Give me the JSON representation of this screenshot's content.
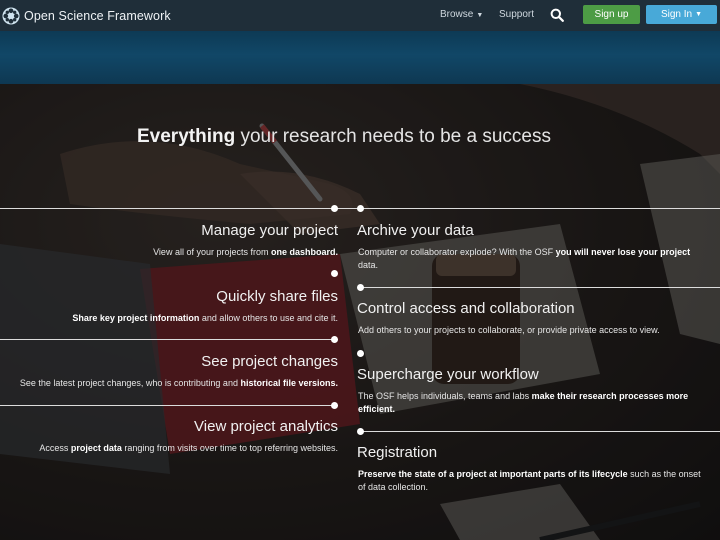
{
  "navbar": {
    "brand": "Open Science Framework",
    "browse_label": "Browse",
    "support_label": "Support",
    "signup_label": "Sign up",
    "signin_label": "Sign In",
    "colors": {
      "bar": "#1f2e39",
      "signup": "#4d9c45",
      "signin": "#48a9d8"
    }
  },
  "section": {
    "title_bold": "Everything",
    "title_rest": " your research needs to be a success"
  },
  "features_left": [
    {
      "title": "Manage your project",
      "desc_before": "View all of your projects from ",
      "desc_bold": "one dashboard.",
      "desc_after": ""
    },
    {
      "title": "Quickly share files",
      "desc_before": "",
      "desc_bold": "Share key project information",
      "desc_after": " and allow others to use and cite it."
    },
    {
      "title": "See project changes",
      "desc_before": "See the latest project changes, who is contributing and ",
      "desc_bold": "historical file versions.",
      "desc_after": ""
    },
    {
      "title": "View project analytics",
      "desc_before": "Access ",
      "desc_bold": "project data",
      "desc_after": " ranging from visits over time to top referring websites."
    }
  ],
  "features_right": [
    {
      "title": "Archive your data",
      "desc_before": "Computer or collaborator explode? With the OSF ",
      "desc_bold": "you will never lose your project",
      "desc_after": " data."
    },
    {
      "title": "Control access and collaboration",
      "desc_before": "Add others to your projects to collaborate, or provide private access to view.",
      "desc_bold": "",
      "desc_after": ""
    },
    {
      "title": "Supercharge your workflow",
      "desc_before": "The OSF helps individuals, teams and labs ",
      "desc_bold": "make their research processes more efficient.",
      "desc_after": ""
    },
    {
      "title": "Registration",
      "desc_before": "",
      "desc_bold": "Preserve the state of a project at important parts of its lifecycle",
      "desc_after": " such as the onset of data collection."
    }
  ]
}
